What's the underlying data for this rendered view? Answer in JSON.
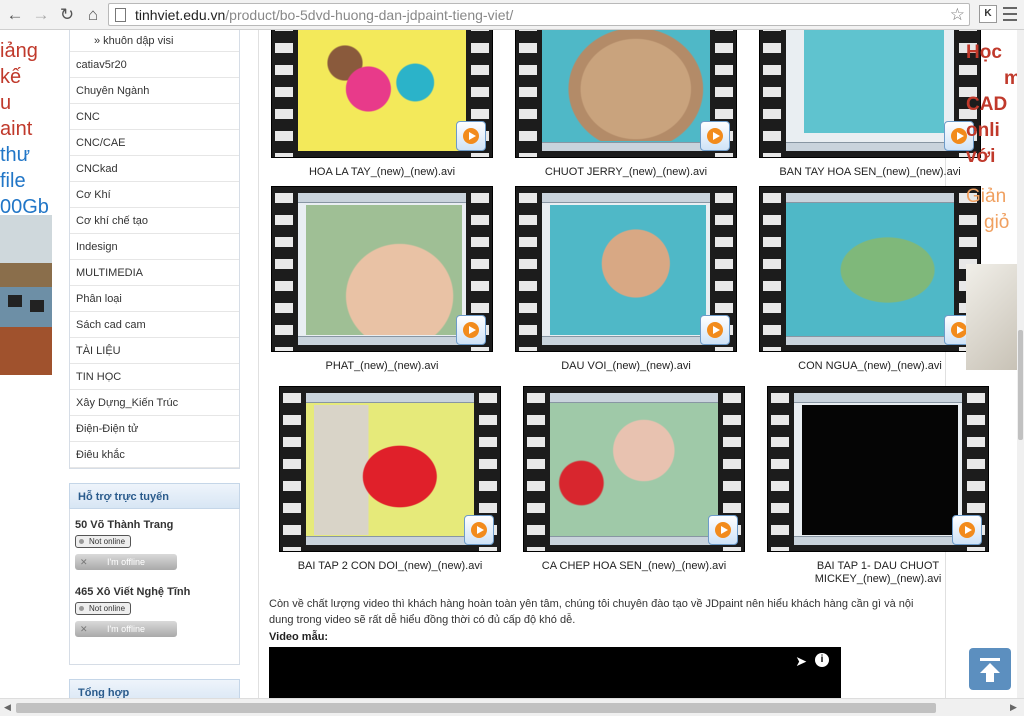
{
  "browser": {
    "url_host": "tinhviet.edu.vn",
    "url_path": "/product/bo-5dvd-huong-dan-jdpaint-tieng-viet/",
    "ext_label": "K"
  },
  "left_banner": {
    "lines": [
      "iảng",
      "kế",
      "u",
      "aint",
      "thư",
      "file",
      "00Gb"
    ]
  },
  "sidebar": {
    "sub_item": "» khuôn dập visi",
    "categories": [
      "catiav5r20",
      "Chuyên Ngành",
      "CNC",
      "CNC/CAE",
      "CNCkad",
      "Cơ Khí",
      "Cơ khí chế tạo",
      "Indesign",
      "MULTIMEDIA",
      "Phân loại",
      "Sách cad cam",
      "TÀI LIỆU",
      "TIN HỌC",
      "Xây Dựng_Kiến Trúc",
      "Điện-Điện tử",
      "Điêu khắc"
    ],
    "support": {
      "title": "Hỗ trợ trực tuyến",
      "agents": [
        {
          "name": "50 Võ Thành Trang",
          "status": "Not online",
          "button": "I'm offline"
        },
        {
          "name": "465 Xô Viết Nghệ Tĩnh",
          "status": "Not online",
          "button": "I'm offline"
        }
      ]
    },
    "summary_title": "Tổng hợp"
  },
  "videos": [
    {
      "caption": "HOA LA TAY_(new)_(new).avi"
    },
    {
      "caption": "CHUOT JERRY_(new)_(new).avi"
    },
    {
      "caption": "BAN TAY HOA SEN_(new)_(new).avi"
    },
    {
      "caption": "PHAT_(new)_(new).avi"
    },
    {
      "caption": "DAU VOI_(new)_(new).avi"
    },
    {
      "caption": "CON NGUA_(new)_(new).avi"
    },
    {
      "caption": "BAI TAP 2 CON DOI_(new)_(new).avi"
    },
    {
      "caption": "CA CHEP HOA SEN_(new)_(new).avi"
    },
    {
      "caption": "BAI TAP 1- DAU CHUOT MICKEY_(new)_(new).avi"
    }
  ],
  "main": {
    "description": "Còn về chất lượng video thì khách hàng hoàn toàn yên tâm, chúng tôi chuyên đào tạo về JDpaint nên hiểu khách hàng cần gì và nội dung trong video sẽ rất dễ hiểu đồng thời có đủ cấp độ khó dễ.",
    "sample_label": "Video mẫu:"
  },
  "right_banner": {
    "lines": [
      "Học",
      "m",
      "CAD",
      "onli",
      "với"
    ],
    "orange_lines": [
      "Giản",
      "giỏ"
    ]
  },
  "colors": {
    "accent_blue": "#2a5b8c",
    "banner_red": "#c0392b",
    "play_orange": "#f28b1c"
  }
}
